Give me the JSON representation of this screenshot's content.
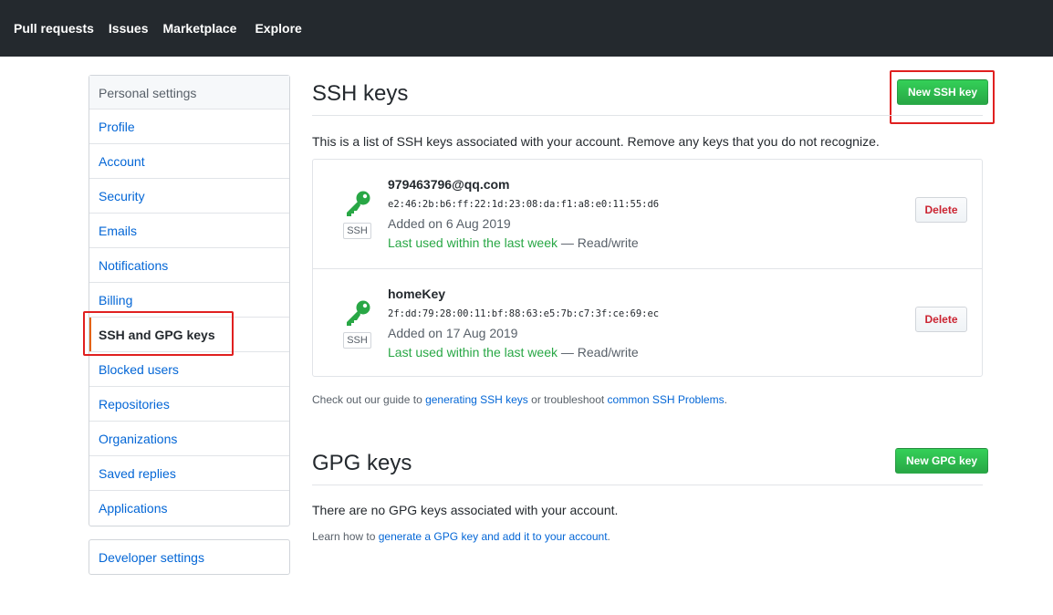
{
  "topnav": {
    "items": [
      "Pull requests",
      "Issues",
      "Marketplace",
      "Explore"
    ]
  },
  "sidebar": {
    "header": "Personal settings",
    "items": [
      {
        "label": "Profile"
      },
      {
        "label": "Account"
      },
      {
        "label": "Security"
      },
      {
        "label": "Emails"
      },
      {
        "label": "Notifications"
      },
      {
        "label": "Billing"
      },
      {
        "label": "SSH and GPG keys",
        "selected": true
      },
      {
        "label": "Blocked users"
      },
      {
        "label": "Repositories"
      },
      {
        "label": "Organizations"
      },
      {
        "label": "Saved replies"
      },
      {
        "label": "Applications"
      }
    ],
    "developer": "Developer settings"
  },
  "ssh": {
    "title": "SSH keys",
    "new_button": "New SSH key",
    "description": "This is a list of SSH keys associated with your account. Remove any keys that you do not recognize.",
    "keys": [
      {
        "title": "979463796@qq.com",
        "fingerprint": "e2:46:2b:b6:ff:22:1d:23:08:da:f1:a8:e0:11:55:d6",
        "added": "Added on 6 Aug 2019",
        "last_used": "Last used within the last week",
        "access": " — Read/write",
        "type_label": "SSH",
        "delete_label": "Delete"
      },
      {
        "title": "homeKey",
        "fingerprint": "2f:dd:79:28:00:11:bf:88:63:e5:7b:c7:3f:ce:69:ec",
        "added": "Added on 17 Aug 2019",
        "last_used": "Last used within the last week",
        "access": " — Read/write",
        "type_label": "SSH",
        "delete_label": "Delete"
      }
    ],
    "guide": {
      "prefix": "Check out our guide to ",
      "link1": "generating SSH keys",
      "middle": " or troubleshoot ",
      "link2": "common SSH Problems",
      "suffix": "."
    }
  },
  "gpg": {
    "title": "GPG keys",
    "new_button": "New GPG key",
    "empty": "There are no GPG keys associated with your account.",
    "learn": {
      "prefix": "Learn how to ",
      "link": "generate a GPG key and add it to your account",
      "suffix": "."
    }
  },
  "colors": {
    "topbar": "#24292e",
    "link": "#0366d6",
    "green": "#28a745",
    "danger": "#cb2431",
    "highlight": "#e02020",
    "selected_accent": "#e36209"
  }
}
